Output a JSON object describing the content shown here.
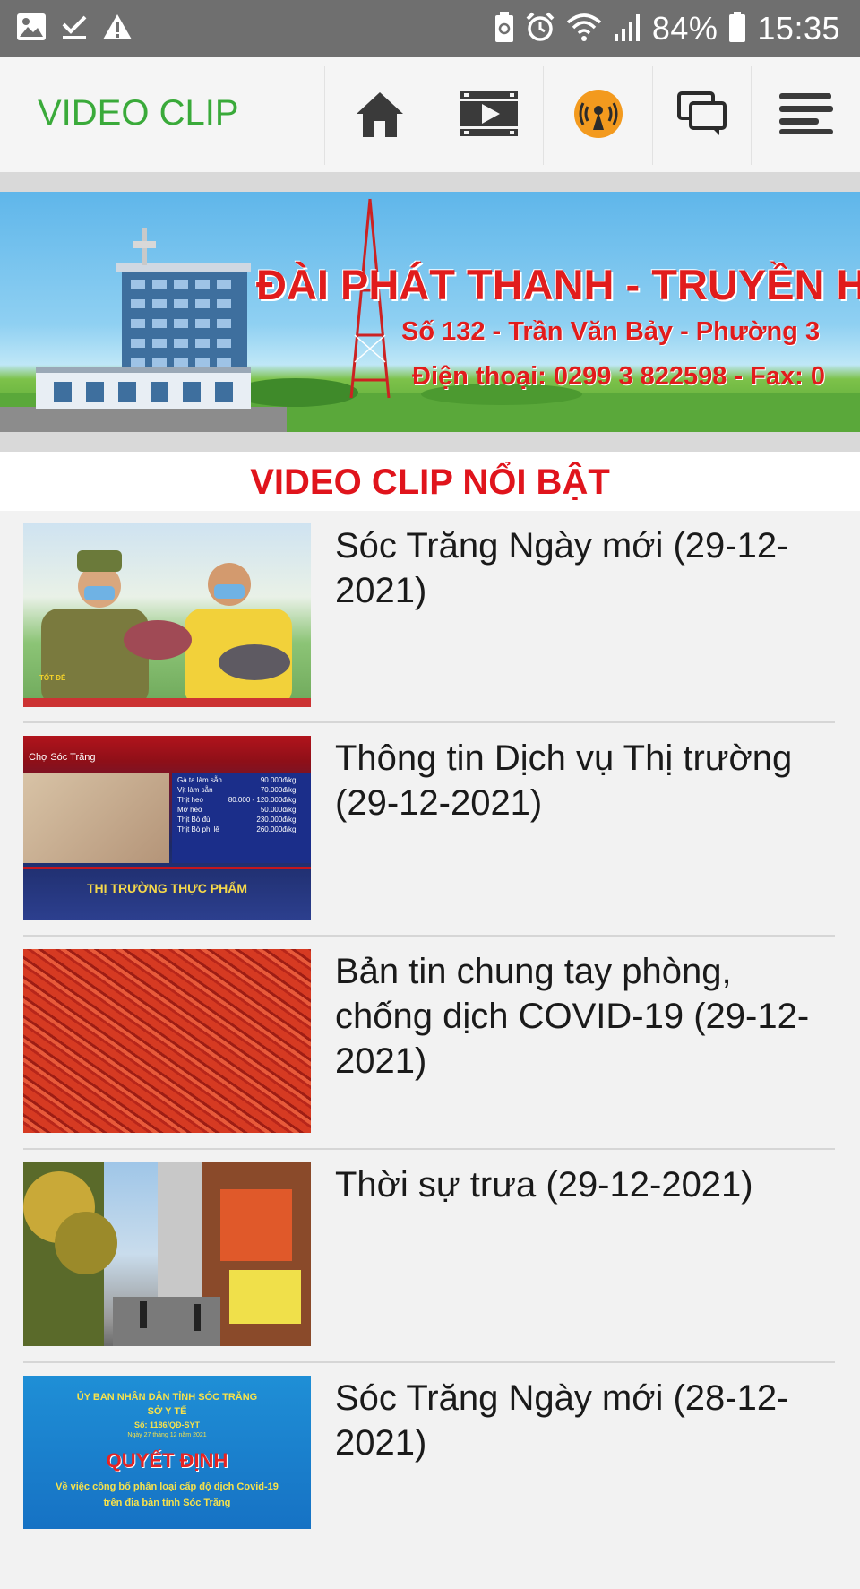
{
  "status_bar": {
    "battery": "84%",
    "time": "15:35",
    "icons_left": [
      "image-icon",
      "download-done-icon",
      "warning-icon"
    ],
    "icons_right": [
      "battery-saver-icon",
      "alarm-icon",
      "wifi-icon",
      "signal-icon",
      "battery-icon"
    ]
  },
  "app_bar": {
    "section_title": "VIDEO CLIP",
    "nav": [
      "home-icon",
      "video-icon",
      "live-radio-icon",
      "chat-icon",
      "menu-icon"
    ],
    "live_color": "#f39a1e"
  },
  "banner": {
    "line1": "ĐÀI PHÁT THANH - TRUYỀN H",
    "line2": "Số 132 - Trần Văn Bảy - Phường 3",
    "line3": "Điện thoại: 0299 3 822598 - Fax: 0"
  },
  "featured": {
    "heading": "VIDEO CLIP NỔI BẬT"
  },
  "items": [
    {
      "title": "Sóc Trăng Ngày mới (29-12-2021)",
      "thumb_logo": "TỐT ĐỂ"
    },
    {
      "title": "Thông tin Dịch vụ Thị trường (29-12-2021)",
      "thumb_tag": "Chợ Sóc Trăng",
      "thumb_banner": "THỊ TRƯỜNG THỰC PHẨM",
      "prices": [
        [
          "Gà ta làm sẵn",
          "90.000đ/kg"
        ],
        [
          "Vịt làm sẵn",
          "70.000đ/kg"
        ],
        [
          "Thịt heo",
          "80.000 - 120.000đ/kg"
        ],
        [
          "Mỡ heo",
          "50.000đ/kg"
        ],
        [
          "Thịt Bò đùi",
          "230.000đ/kg"
        ],
        [
          "Thịt Bò phi lê",
          "260.000đ/kg"
        ]
      ]
    },
    {
      "title": "Bản tin chung tay phòng, chống dịch COVID-19 (29-12-2021)"
    },
    {
      "title": "Thời sự trưa (29-12-2021)"
    },
    {
      "title": "Sóc Trăng Ngày mới (28-12-2021)",
      "thumb_l1": "ỦY BAN NHÂN DÂN TỈNH SÓC TRĂNG",
      "thumb_l2": "SỞ Y TẾ",
      "thumb_l3": "Số: 1186/QĐ-SYT",
      "thumb_l4": "Ngày 27 tháng 12 năm 2021",
      "thumb_l5": "QUYẾT ĐỊNH",
      "thumb_l6": "Về việc công bố phân loại cấp độ dịch Covid-19",
      "thumb_l7": "trên địa bàn tỉnh Sóc Trăng"
    }
  ]
}
